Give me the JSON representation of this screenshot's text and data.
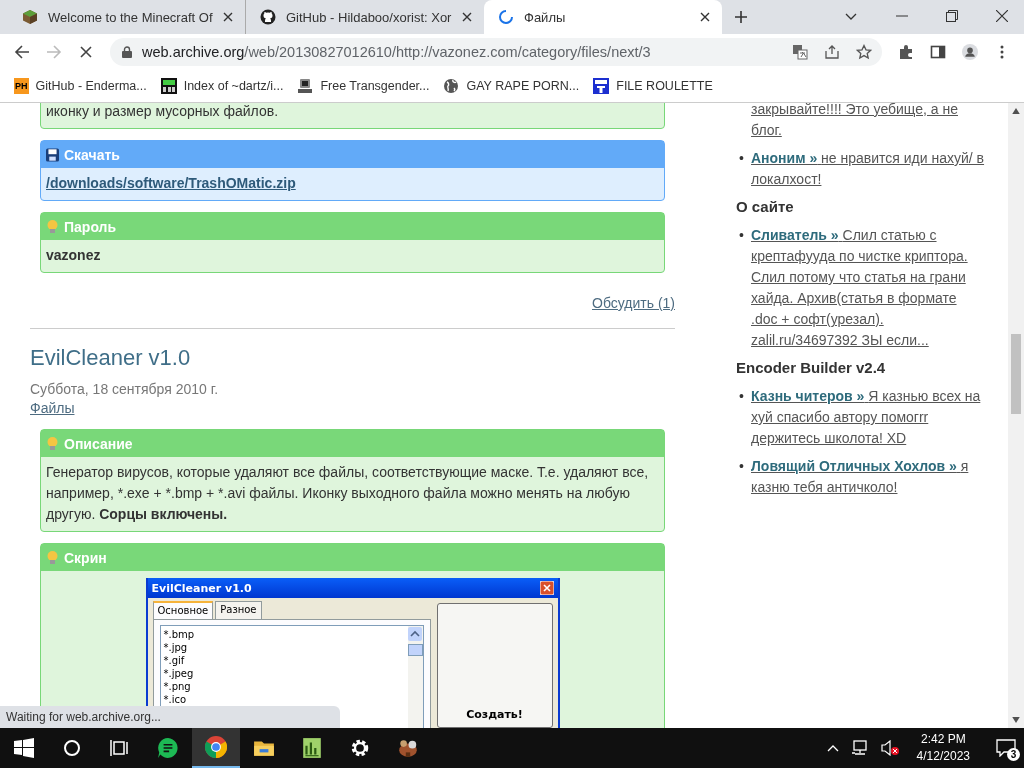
{
  "browser": {
    "tabs": [
      {
        "title": "Welcome to the Minecraft Of",
        "kind": "cube",
        "selected": false
      },
      {
        "title": "GitHub - Hildaboo/xorist: Xor",
        "kind": "github",
        "selected": false
      },
      {
        "title": "Файлы",
        "kind": "loading",
        "selected": true
      }
    ],
    "address": {
      "host": "web.archive.org",
      "path": "/web/20130827012610/http://vazonez.com/category/files/next/3"
    },
    "bookmarks": [
      {
        "label": "GitHub - Enderma...",
        "kind": "badge",
        "badge": "PH"
      },
      {
        "label": "Index of ~dartz/i...",
        "kind": "grid"
      },
      {
        "label": "Free Transgender...",
        "kind": "figure"
      },
      {
        "label": "GAY RAPE PORN...",
        "kind": "globe"
      },
      {
        "label": "FILE ROULETTE",
        "kind": "square"
      }
    ],
    "status": "Waiting for web.archive.org..."
  },
  "page": {
    "lead_text": "иконку и размер мусорных файлов.",
    "download": {
      "heading": "Скачать",
      "link": "/downloads/software/TrashOMatic.zip"
    },
    "password": {
      "heading": "Пароль",
      "value": "vazonez"
    },
    "discuss": "Обсудить (1)",
    "post": {
      "title": "EvilCleaner v1.0",
      "date": "Суббота, 18 сентября 2010 г.",
      "category": "Файлы",
      "description": {
        "heading": "Описание",
        "text": "Генератор вирусов, которые удаляют все файлы, соответствующие маске. Т.е. удаляют все, например, *.exe + *.bmp + *.avi файлы. Иконку выходного файла можно менять на любую другую. **Сорцы включены.**"
      },
      "screen": {
        "heading": "Скрин",
        "window": {
          "title": "EvilCleaner v1.0",
          "tabs": [
            {
              "label": "Основное",
              "selected": true
            },
            {
              "label": "Разное",
              "selected": false
            }
          ],
          "list": [
            "*.bmp",
            "*.jpg",
            "*.gif",
            "*.jpeg",
            "*.png",
            "*.ico"
          ],
          "button": "Создать!"
        }
      }
    }
  },
  "sidebar": {
    "groups": [
      {
        "comments": [
          {
            "text": "закрывайте!!!! Это уебище, а не блог."
          },
          {
            "bullet": "•",
            "author": "Аноним »",
            "text": "не нравится иди нахуй/ в локалхост!"
          }
        ]
      },
      {
        "heading": "О сайте",
        "comments": [
          {
            "bullet": "•",
            "author": "Сливатель »",
            "text": "Слил статью с крептафууда по чистке криптора. Слил потому что статья на грани хайда. Архив(статья в формате .doc + софт(урезал). zalil.ru/34697392 ЗЫ если..."
          }
        ]
      },
      {
        "heading": "Encoder Builder v2.4",
        "comments": [
          {
            "bullet": "•",
            "author": "Казнь читеров »",
            "text": "Я казнью всех на хуй спасибо автору помогrr держитесь школота! XD"
          },
          {
            "bullet": "•",
            "author": "Ловящий Отличных Хохлов »",
            "text": "я казню тебя античколо!"
          }
        ]
      }
    ]
  },
  "taskbar": {
    "apps": [
      {
        "kind": "sheets",
        "active": false
      },
      {
        "kind": "chrome",
        "active": true
      },
      {
        "kind": "folder",
        "active": false
      },
      {
        "kind": "chart",
        "active": false
      },
      {
        "kind": "gear",
        "active": false
      },
      {
        "kind": "game",
        "active": false
      }
    ],
    "time": "2:42 PM",
    "date": "4/12/2023",
    "notifications": "3"
  }
}
